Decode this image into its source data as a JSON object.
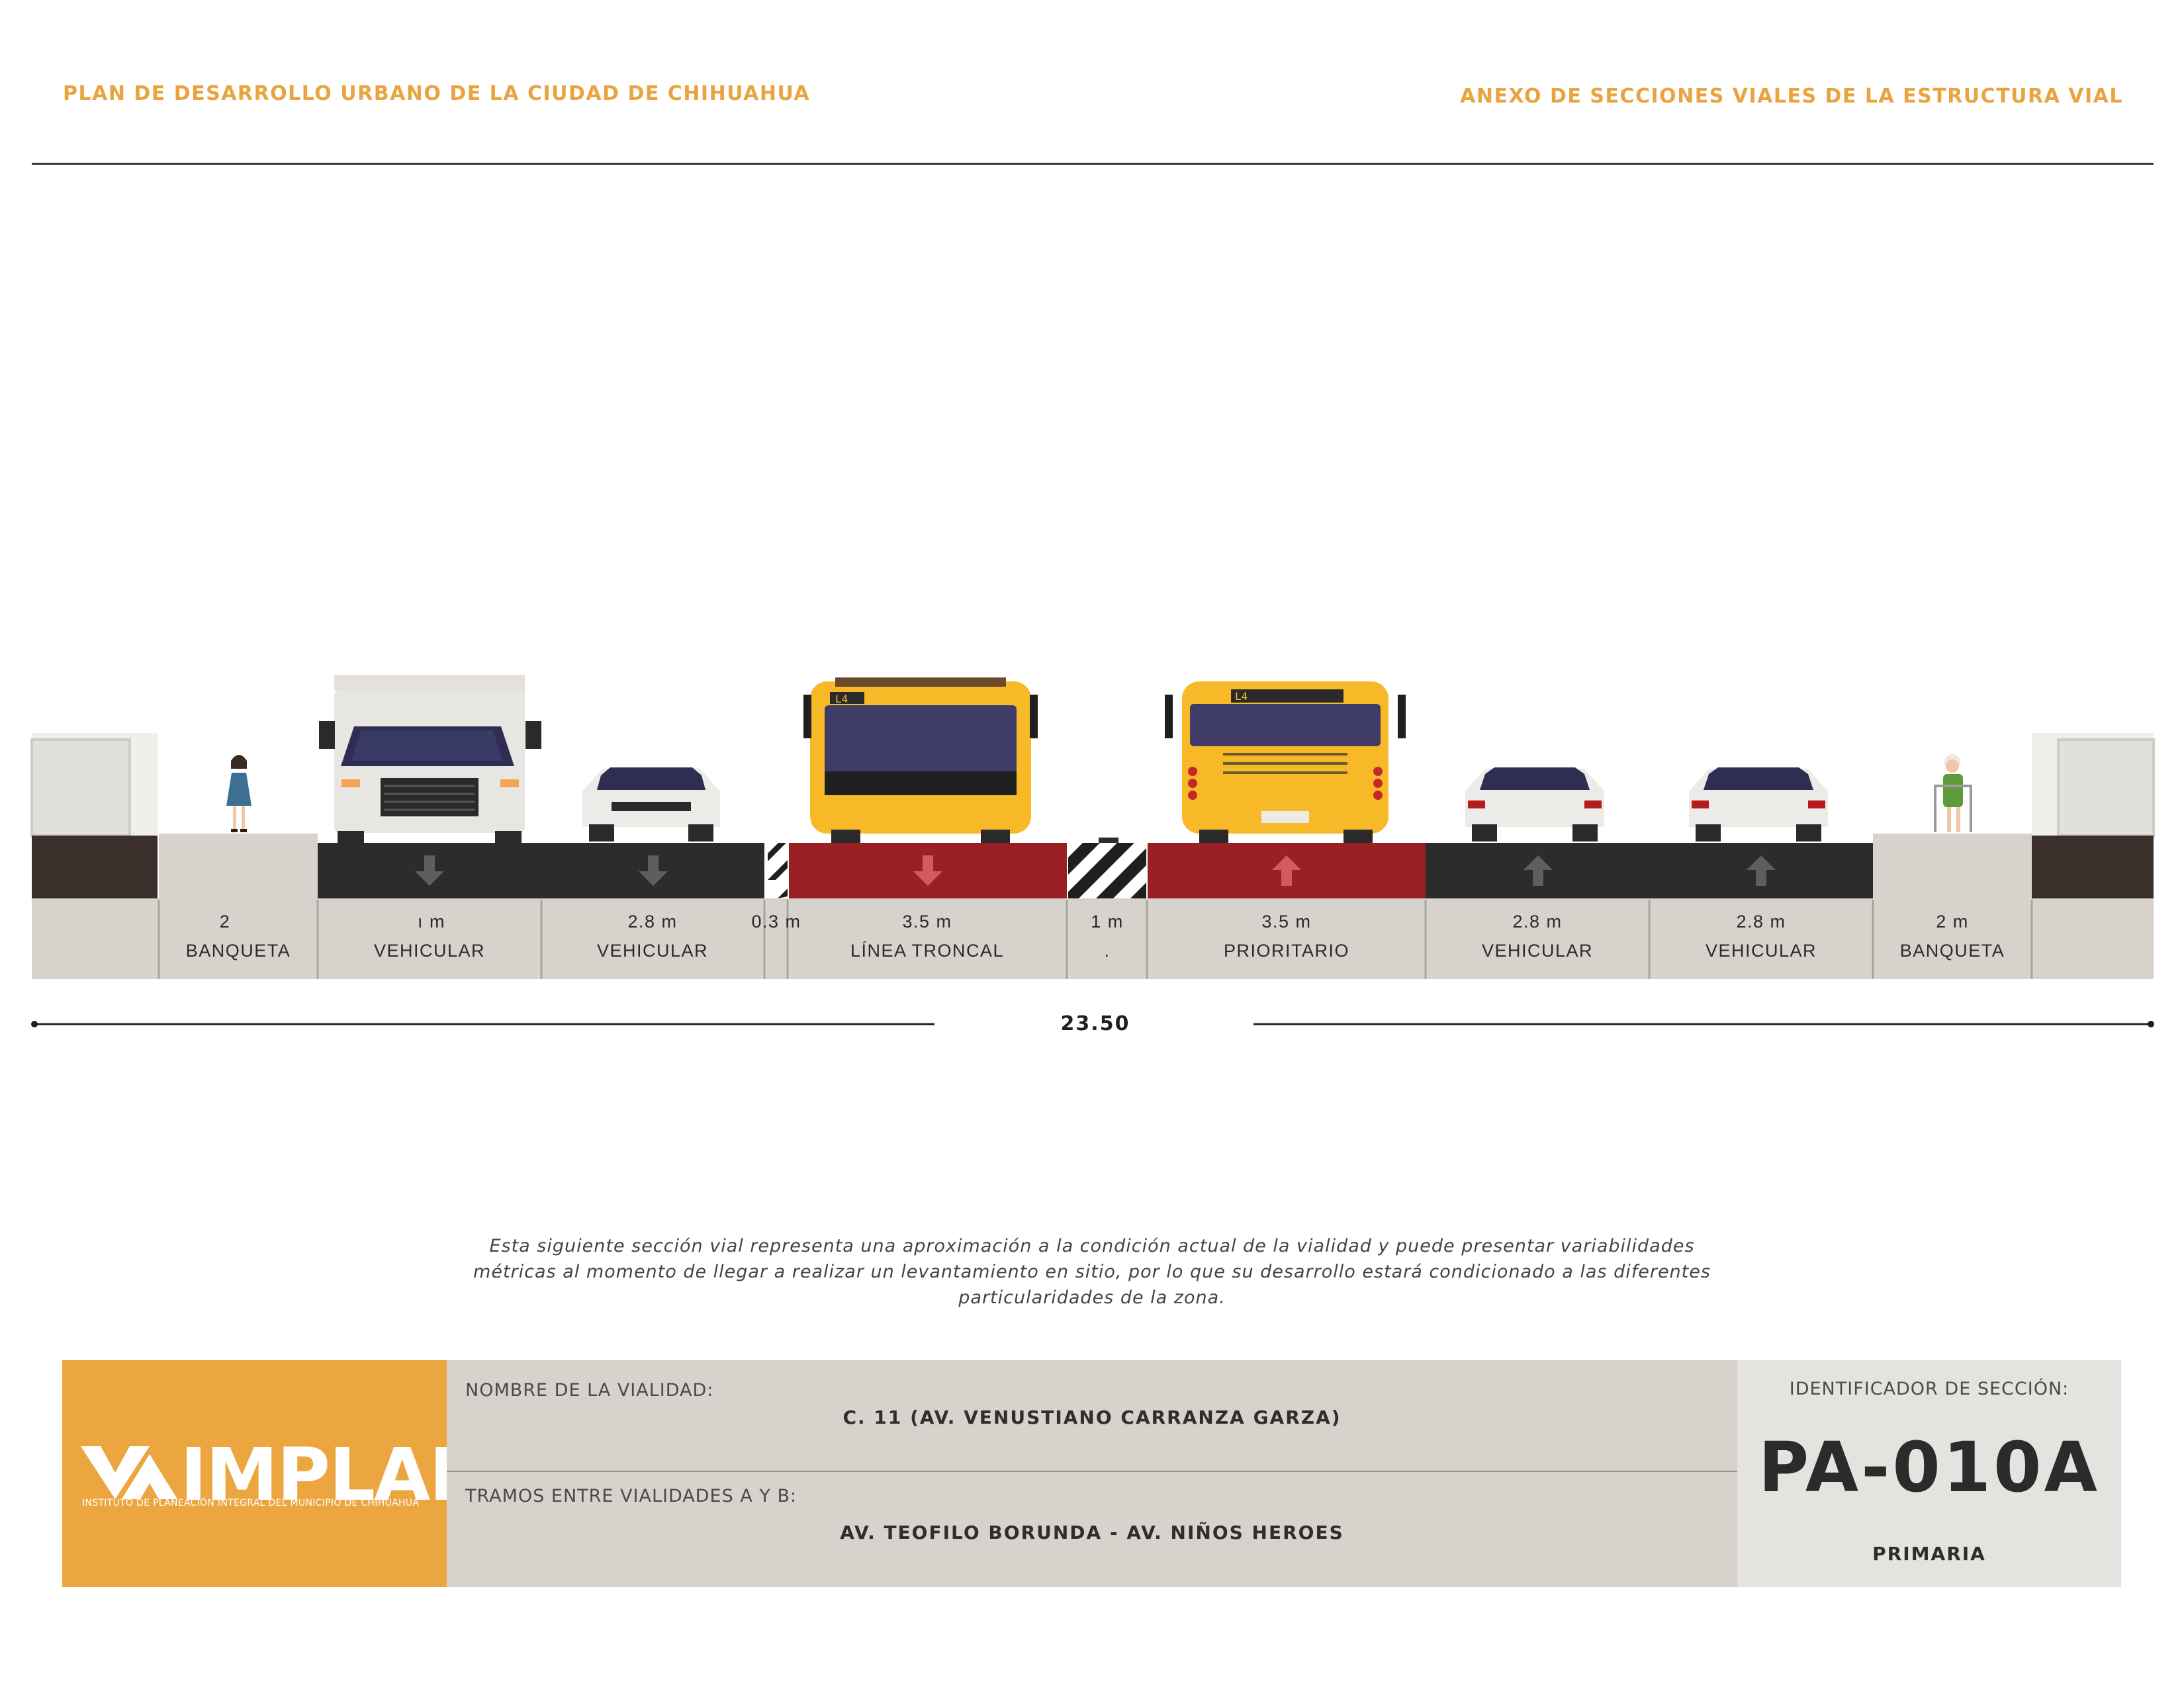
{
  "header": {
    "left_title": "PLAN DE DESARROLLO URBANO DE LA CIUDAD DE CHIHUAHUA",
    "right_title": "ANEXO DE SECCIONES VIALES DE LA ESTRUCTURA VIAL"
  },
  "section": {
    "segments": [
      {
        "dimension": "2",
        "name": "BANQUETA"
      },
      {
        "dimension": "ı m",
        "name": "VEHICULAR"
      },
      {
        "dimension": "2.8 m",
        "name": "VEHICULAR"
      },
      {
        "dimension": "0.3 m",
        "name": ""
      },
      {
        "dimension": "3.5 m",
        "name": "LÍNEA TRONCAL"
      },
      {
        "dimension": "1 m",
        "name": "."
      },
      {
        "dimension": "3.5 m",
        "name": "PRIORITARIO"
      },
      {
        "dimension": "2.8 m",
        "name": "VEHICULAR"
      },
      {
        "dimension": "2.8 m",
        "name": "VEHICULAR"
      },
      {
        "dimension": "2 m",
        "name": "BANQUETA"
      }
    ],
    "total_width": "23.50",
    "bus_route_label": "L4"
  },
  "disclaimer": "Esta siguiente sección vial representa una aproximación a la condición actual de la vialidad y puede presentar variabilidades métricas al momento de llegar a realizar un levantamiento en sitio, por lo que su desarrollo estará condicionado a las diferentes particularidades de la zona.",
  "logo": {
    "name": "IMPLAN",
    "subtitle": "INSTITUTO DE PLANEACIÓN INTEGRAL DEL MUNICIPIO DE CHIHUAHUA"
  },
  "info": {
    "road_name_label": "NOMBRE DE LA VIALIDAD:",
    "road_name": "C. 11 (AV. VENUSTIANO CARRANZA GARZA)",
    "segment_label": "TRAMOS ENTRE VIALIDADES A Y B:",
    "segment": "AV. TEOFILO BORUNDA - AV. NIÑOS HEROES"
  },
  "identifier": {
    "label": "IDENTIFICADOR DE SECCIÓN:",
    "code": "PA-010A",
    "type": "PRIMARIA"
  },
  "colors": {
    "accent": "#e9a440",
    "asphalt": "#2b2d2c",
    "bus_lane": "#9b2024",
    "sidewalk": "#d7d2cc",
    "bus": "#f7b928"
  }
}
